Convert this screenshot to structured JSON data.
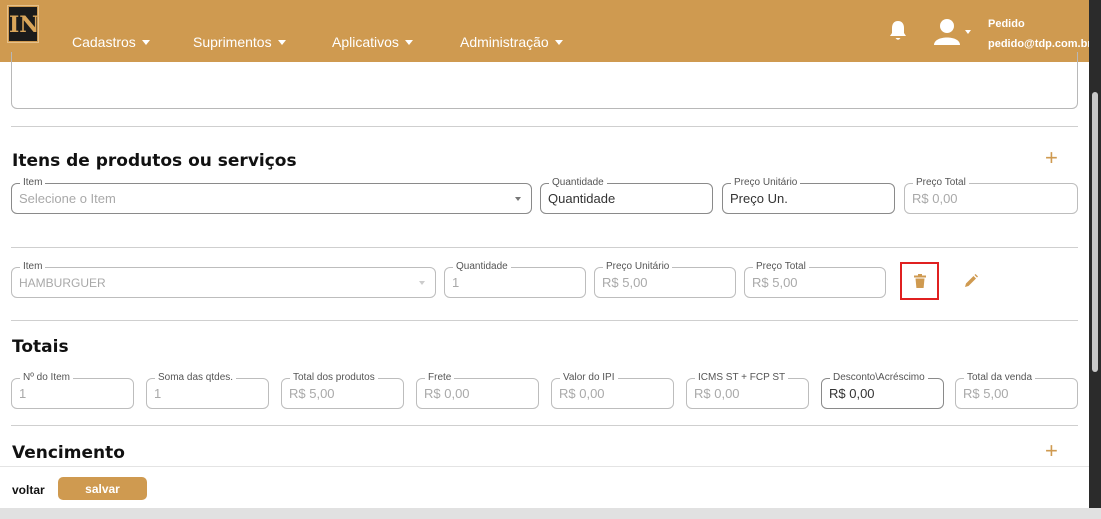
{
  "header": {
    "logo_text": "IN",
    "nav": [
      {
        "label": "Cadastros"
      },
      {
        "label": "Suprimentos"
      },
      {
        "label": "Aplicativos"
      },
      {
        "label": "Administração"
      }
    ],
    "user_name": "Pedido",
    "user_email": "pedido@tdp.com.br",
    "icons": {
      "notifications": "bell-icon",
      "user": "user-icon"
    }
  },
  "itens": {
    "title": "Itens de produtos ou serviços",
    "new_item": {
      "item_label": "Item",
      "item_placeholder": "Selecione o Item",
      "qty_label": "Quantidade",
      "qty_placeholder": "Quantidade",
      "unit_label": "Preço Unitário",
      "unit_placeholder": "Preço Un.",
      "total_label": "Preço Total",
      "total_value": "R$ 0,00"
    },
    "rows": [
      {
        "item_label": "Item",
        "item_value": "HAMBURGUER",
        "qty_label": "Quantidade",
        "qty_value": "1",
        "unit_label": "Preço Unitário",
        "unit_value": "R$ 5,00",
        "total_label": "Preço Total",
        "total_value": "R$ 5,00"
      }
    ]
  },
  "totais": {
    "title": "Totais",
    "fields": [
      {
        "label": "Nº do Item",
        "value": "1"
      },
      {
        "label": "Soma das qtdes.",
        "value": "1"
      },
      {
        "label": "Total dos produtos",
        "value": "R$ 5,00"
      },
      {
        "label": "Frete",
        "value": "R$ 0,00"
      },
      {
        "label": "Valor do IPI",
        "value": "R$ 0,00"
      },
      {
        "label": "ICMS ST + FCP ST",
        "value": "R$ 0,00"
      },
      {
        "label": "Desconto\\Acréscimo",
        "value": "R$ 0,00"
      },
      {
        "label": "Total da venda",
        "value": "R$ 5,00"
      }
    ]
  },
  "vencimento": {
    "title": "Vencimento"
  },
  "footer": {
    "back_label": "voltar",
    "save_label": "salvar"
  },
  "colors": {
    "accent": "#cf9a50",
    "delete_highlight": "#e02020",
    "page_bg": "#ffffff"
  }
}
